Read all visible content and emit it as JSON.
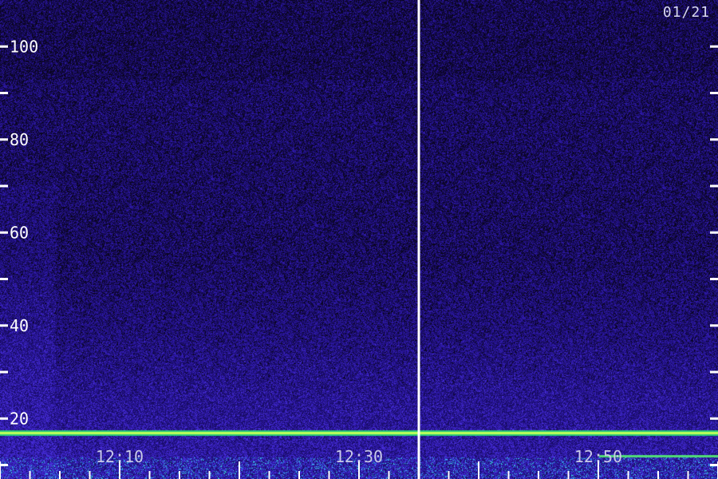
{
  "date_label": "01/21",
  "chart_data": {
    "type": "heatmap",
    "title": "",
    "xlabel": "",
    "ylabel": "",
    "y_ticks_labeled": [
      "20",
      "40",
      "60",
      "80",
      "100"
    ],
    "y_ticks_minor": [
      10,
      30,
      50,
      70,
      90
    ],
    "ylim": [
      7,
      110
    ],
    "x_time_labels": [
      "12:10",
      "12:30",
      "12:50"
    ],
    "x_range_minutes": [
      "12:00",
      "13:00"
    ],
    "marker_time": "12:35",
    "colors": {
      "background": "#120a3a",
      "noise_low": "#1a0d55",
      "noise_mid": "#3a1fb0",
      "band_strong": "#39e070",
      "band_peak": "#d8ff60",
      "axis": "#ffffff"
    },
    "features": [
      {
        "kind": "broadband_noise",
        "y_from": 7,
        "y_to": 55,
        "intensity": "moderate"
      },
      {
        "kind": "narrowband_line",
        "y": 17,
        "intensity": "strong"
      },
      {
        "kind": "narrowband_line",
        "y": 12,
        "intensity": "medium",
        "start": "12:50"
      }
    ]
  }
}
